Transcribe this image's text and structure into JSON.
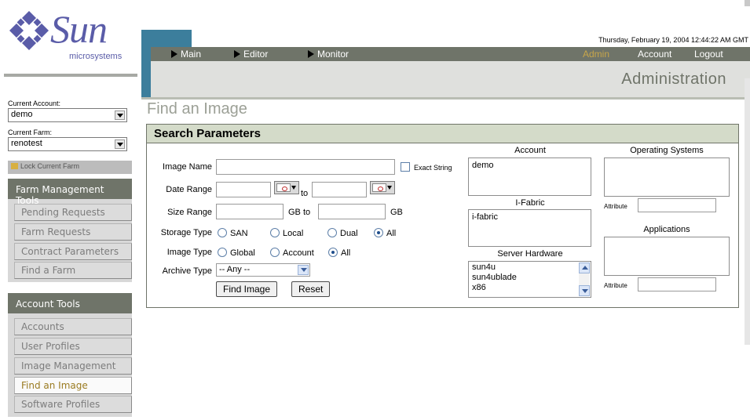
{
  "header": {
    "logo_word": "Sun",
    "logo_sub": "microsystems",
    "nav": [
      "Main",
      "Editor",
      "Monitor"
    ],
    "right_nav": [
      "Admin",
      "Account",
      "Logout"
    ],
    "datetime": "Thursday, February 19, 2004 12:44:22 AM GMT",
    "section_title": "Administration"
  },
  "sidebar": {
    "current_account_label": "Current Account:",
    "current_account_value": "demo",
    "current_farm_label": "Current Farm:",
    "current_farm_value": "renotest",
    "lock_label": "Lock Current Farm",
    "farm_tools_title": "Farm Management Tools",
    "farm_tools": [
      "Pending Requests",
      "Farm Requests",
      "Contract Parameters",
      "Find a Farm"
    ],
    "account_tools_title": "Account Tools",
    "account_tools": [
      "Accounts",
      "User Profiles",
      "Image Management",
      "Find an Image",
      "Software Profiles"
    ],
    "active_item": "Find an Image"
  },
  "main": {
    "page_title": "Find an Image",
    "panel_title": "Search Parameters",
    "image_name_label": "Image Name",
    "exact_string_label": "Exact String",
    "date_range_label": "Date Range",
    "to_label": "to",
    "size_range_label": "Size Range",
    "gb_to_label": "GB to",
    "gb_label": "GB",
    "storage_type_label": "Storage Type",
    "storage_options": [
      "SAN",
      "Local",
      "Dual",
      "All"
    ],
    "storage_selected": "All",
    "image_type_label": "Image Type",
    "image_type_options": [
      "Global",
      "Account",
      "All"
    ],
    "image_type_selected": "All",
    "archive_type_label": "Archive Type",
    "archive_type_value": "-- Any --",
    "find_button": "Find Image",
    "reset_button": "Reset",
    "account_label": "Account",
    "account_items": [
      "demo"
    ],
    "ifabric_label": "I-Fabric",
    "ifabric_items": [
      "i-fabric"
    ],
    "server_hw_label": "Server Hardware",
    "server_hw_items": [
      "sun4u",
      "sun4ublade",
      "x86"
    ],
    "os_label": "Operating Systems",
    "attribute_label": "Attribute",
    "applications_label": "Applications"
  },
  "colors": {
    "nav_bar": "#6f7469",
    "tab_accent": "#3c7e9c",
    "panel_header": "#d4dbc9",
    "active_item_text": "#9a7b20",
    "admin_highlight": "#c8a64a"
  }
}
